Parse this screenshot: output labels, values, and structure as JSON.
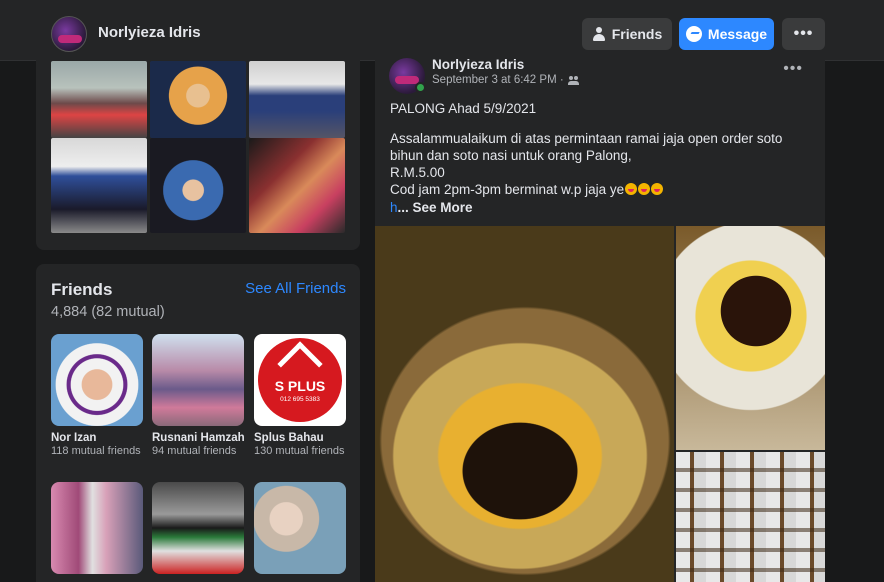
{
  "header": {
    "profile_name": "Norlyieza Idris",
    "friends_button": "Friends",
    "message_button": "Message",
    "more_button": "•••"
  },
  "friends_section": {
    "title": "Friends",
    "see_all": "See All Friends",
    "count": "4,884 (82 mutual)",
    "items": [
      {
        "name": "Nor Izan",
        "mutual": "118 mutual friends"
      },
      {
        "name": "Rusnani Hamzah",
        "mutual": "94 mutual friends"
      },
      {
        "name": "Splus Bahau",
        "mutual": "130 mutual friends"
      },
      {
        "name": "",
        "mutual": ""
      },
      {
        "name": "",
        "mutual": ""
      },
      {
        "name": "",
        "mutual": ""
      }
    ],
    "splus_logo_text": "S PLUS",
    "splus_logo_phone": "012 695 5383"
  },
  "post": {
    "author": "Norlyieza Idris",
    "timestamp": "September 3 at 6:42 PM ·",
    "more": "•••",
    "title_line": "PALONG Ahad 5/9/2021",
    "body_lines": [
      "Assalammualaikum di atas permintaan ramai jaja open order soto bihun dan soto nasi untuk orang Palong,",
      "R.M.5.00",
      "Cod jam 2pm-3pm berminat w.p jaja ye"
    ],
    "see_more_prefix": "h",
    "see_more_label": "... See More"
  },
  "icons": {
    "friends_button_icon": "person-icon",
    "message_button_icon": "messenger-icon",
    "audience_icon": "friends-audience-icon",
    "emoji": "face-blowing-kiss-emoji"
  },
  "colors": {
    "background": "#18191a",
    "card": "#242526",
    "accent": "#2d88ff",
    "online": "#31a24c"
  }
}
